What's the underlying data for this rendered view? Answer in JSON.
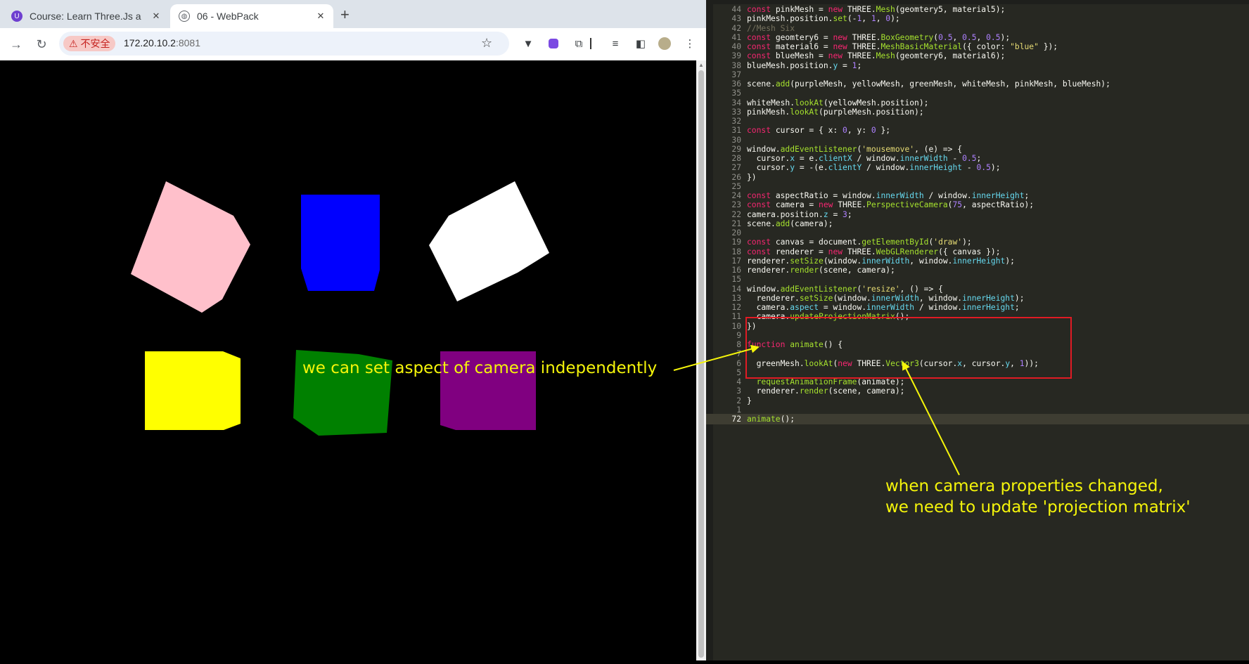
{
  "browser": {
    "tabs": [
      {
        "title": "Course: Learn Three.Js a",
        "favicon": "udemy-icon",
        "active": false
      },
      {
        "title": "06 - WebPack",
        "favicon": "globe-icon",
        "active": true
      }
    ],
    "security_label": "不安全",
    "url_host": "172.20.10.2",
    "url_port": ":8081"
  },
  "scene": {
    "background": "#000000",
    "meshes": [
      {
        "name": "pink",
        "color": "#ffc0cb"
      },
      {
        "name": "blue",
        "color": "#0000ff"
      },
      {
        "name": "white",
        "color": "#ffffff"
      },
      {
        "name": "yellow",
        "color": "#ffff00"
      },
      {
        "name": "green",
        "color": "#008000"
      },
      {
        "name": "purple",
        "color": "#800080"
      }
    ]
  },
  "editor": {
    "current_line": "72",
    "lines": [
      {
        "n": "44",
        "t": "const pinkMesh = new THREE.Mesh(geomtery5, material5);"
      },
      {
        "n": "43",
        "t": "pinkMesh.position.set(-1, 1, 0);"
      },
      {
        "n": "42",
        "t": "//Mesh Six"
      },
      {
        "n": "41",
        "t": "const geomtery6 = new THREE.BoxGeometry(0.5, 0.5, 0.5);"
      },
      {
        "n": "40",
        "t": "const material6 = new THREE.MeshBasicMaterial({ color: \"blue\" });"
      },
      {
        "n": "39",
        "t": "const blueMesh = new THREE.Mesh(geomtery6, material6);"
      },
      {
        "n": "38",
        "t": "blueMesh.position.y = 1;"
      },
      {
        "n": "37",
        "t": ""
      },
      {
        "n": "36",
        "t": "scene.add(purpleMesh, yellowMesh, greenMesh, whiteMesh, pinkMesh, blueMesh);"
      },
      {
        "n": "35",
        "t": ""
      },
      {
        "n": "34",
        "t": "whiteMesh.lookAt(yellowMesh.position);"
      },
      {
        "n": "33",
        "t": "pinkMesh.lookAt(purpleMesh.position);"
      },
      {
        "n": "32",
        "t": ""
      },
      {
        "n": "31",
        "t": "const cursor = { x: 0, y: 0 };"
      },
      {
        "n": "30",
        "t": ""
      },
      {
        "n": "29",
        "t": "window.addEventListener('mousemove', (e) => {"
      },
      {
        "n": "28",
        "t": "  cursor.x = e.clientX / window.innerWidth - 0.5;"
      },
      {
        "n": "27",
        "t": "  cursor.y = -(e.clientY / window.innerHeight - 0.5);"
      },
      {
        "n": "26",
        "t": "})"
      },
      {
        "n": "25",
        "t": ""
      },
      {
        "n": "24",
        "t": "const aspectRatio = window.innerWidth / window.innerHeight;"
      },
      {
        "n": "23",
        "t": "const camera = new THREE.PerspectiveCamera(75, aspectRatio);"
      },
      {
        "n": "22",
        "t": "camera.position.z = 3;"
      },
      {
        "n": "21",
        "t": "scene.add(camera);"
      },
      {
        "n": "20",
        "t": ""
      },
      {
        "n": "19",
        "t": "const canvas = document.getElementById('draw');"
      },
      {
        "n": "18",
        "t": "const renderer = new THREE.WebGLRenderer({ canvas });"
      },
      {
        "n": "17",
        "t": "renderer.setSize(window.innerWidth, window.innerHeight);"
      },
      {
        "n": "16",
        "t": "renderer.render(scene, camera);"
      },
      {
        "n": "15",
        "t": ""
      },
      {
        "n": "14",
        "t": "window.addEventListener('resize', () => {"
      },
      {
        "n": "13",
        "t": "  renderer.setSize(window.innerWidth, window.innerHeight);"
      },
      {
        "n": "12",
        "t": "  camera.aspect = window.innerWidth / window.innerHeight;"
      },
      {
        "n": "11",
        "t": "  camera.updateProjectionMatrix();"
      },
      {
        "n": "10",
        "t": "})"
      },
      {
        "n": "9",
        "t": ""
      },
      {
        "n": "8",
        "t": "function animate() {"
      },
      {
        "n": "7",
        "t": ""
      },
      {
        "n": "6",
        "t": "  greenMesh.lookAt(new THREE.Vector3(cursor.x, cursor.y, 1));"
      },
      {
        "n": "5",
        "t": ""
      },
      {
        "n": "4",
        "t": "  requestAnimationFrame(animate);"
      },
      {
        "n": "3",
        "t": "  renderer.render(scene, camera);"
      },
      {
        "n": "2",
        "t": "}"
      },
      {
        "n": "1",
        "t": ""
      },
      {
        "n": "72",
        "t": "animate();"
      }
    ]
  },
  "annotations": {
    "aspect_note": "we can set aspect of camera independently",
    "projection_note_line1": "when camera properties changed,",
    "projection_note_line2": "we need to update 'projection matrix'",
    "color": "#f5f50a"
  }
}
